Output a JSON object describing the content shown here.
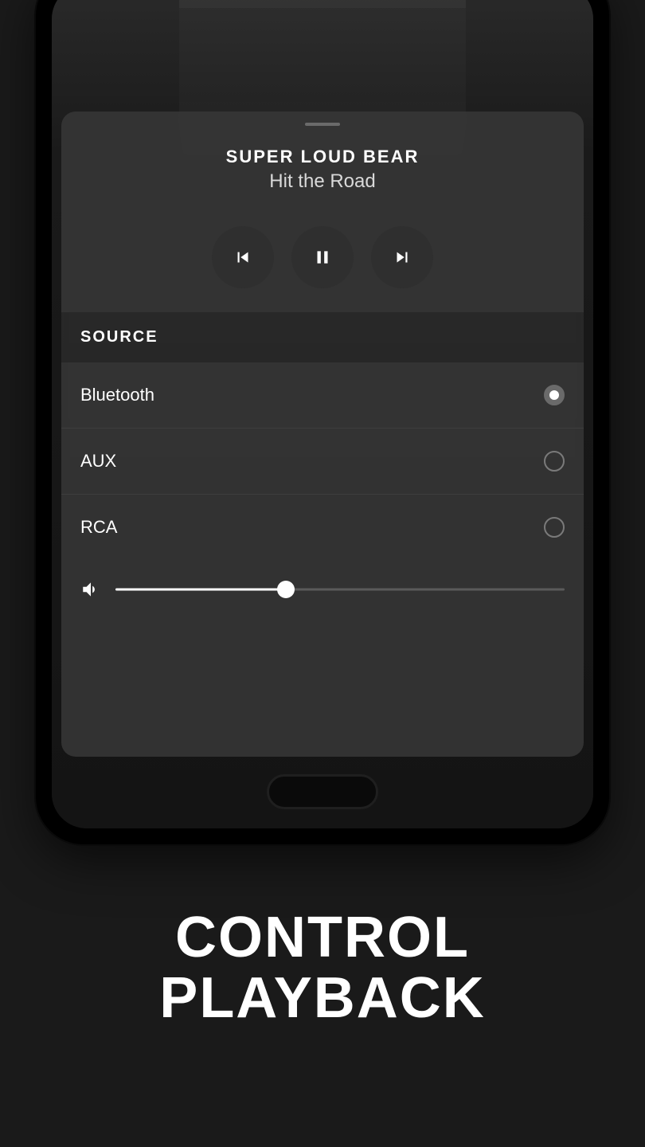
{
  "now_playing": {
    "artist": "SUPER LOUD BEAR",
    "track": "Hit the Road"
  },
  "source": {
    "header": "SOURCE",
    "items": [
      {
        "label": "Bluetooth",
        "selected": true
      },
      {
        "label": "AUX",
        "selected": false
      },
      {
        "label": "RCA",
        "selected": false
      }
    ]
  },
  "volume": {
    "percent": 38
  },
  "caption": {
    "line1": "CONTROL",
    "line2": "PLAYBACK"
  }
}
